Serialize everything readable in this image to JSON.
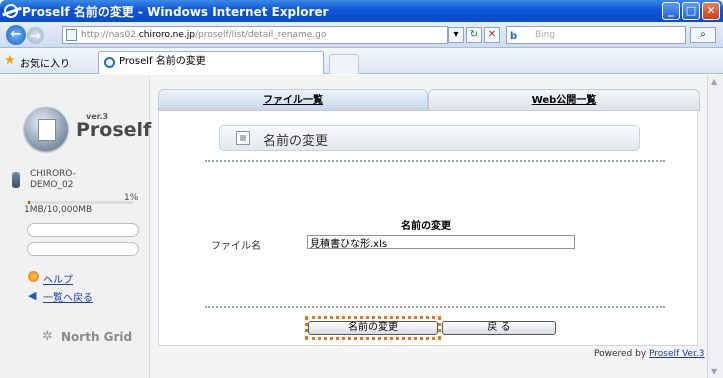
{
  "window": {
    "title": "Proself 名前の変更 - Windows Internet Explorer",
    "controls": [
      "_",
      "□",
      "✕"
    ]
  },
  "address": {
    "url_prefix": "http://nas02.",
    "url_host": "chiroro.ne.jp",
    "url_path": "/proself/list/detail_rename.go",
    "search_placeholder": "Bing",
    "search_engine": "b"
  },
  "favorites": {
    "label": "お気に入り",
    "tab_title": "Proself 名前の変更"
  },
  "sidebar": {
    "logo_version": "ver.3",
    "logo_name": "Proself",
    "user_name": "CHIRORO-DEMO_02",
    "quota_percent": 1,
    "quota_percent_label": "1%",
    "quota_text": "1MB/10,000MB",
    "links": {
      "help": "ヘルプ",
      "back_to_list": "一覧へ戻る"
    },
    "footer_brand": "North Grid"
  },
  "tabs": {
    "file_list": "ファイル一覧",
    "web_public_list": "Web公開一覧"
  },
  "main": {
    "page_title": "名前の変更",
    "section_heading": "名前の変更",
    "field_label": "ファイル名",
    "field_value": "見積書ひな形.xls",
    "rename_button": "名前の変更",
    "back_button": "戻 る"
  },
  "footer": {
    "powered_prefix": "Powered by ",
    "powered_link": "Proself Ver.3"
  },
  "colors": {
    "highlight": "#e8751a",
    "link": "#1a3da8",
    "titlebar": "#0f55d6"
  }
}
